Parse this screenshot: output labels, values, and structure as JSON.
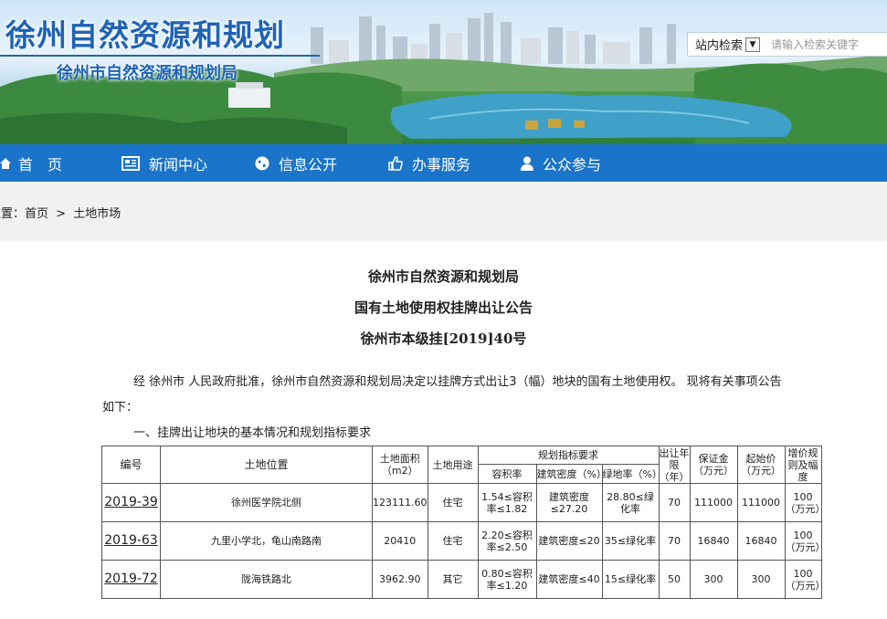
{
  "header": {
    "title": "徐州自然资源和规划",
    "subtitle": "徐州市自然资源和规划局"
  },
  "search": {
    "scope_label": "站内检索",
    "placeholder": "请输入检索关键字"
  },
  "nav": [
    {
      "label": "首　页",
      "icon": "home-icon"
    },
    {
      "label": "新闻中心",
      "icon": "newspaper-icon"
    },
    {
      "label": "信息公开",
      "icon": "globe-icon"
    },
    {
      "label": "办事服务",
      "icon": "thumbs-up-icon"
    },
    {
      "label": "公众参与",
      "icon": "user-icon"
    }
  ],
  "breadcrumb": {
    "prefix": "位置：",
    "home": "首页",
    "separator": ">",
    "current": "土地市场"
  },
  "article": {
    "org": "徐州市自然资源和规划局",
    "title": "国有土地使用权挂牌出让公告",
    "number": "徐州市本级挂[2019]40号",
    "intro_line1": "经 徐州市 人民政府批准，徐州市自然资源和规划局决定以挂牌方式出让3（幅）地块的国有土地使用权。 现将有关事项公告",
    "intro_line2": "如下：",
    "section1": "一、挂牌出让地块的基本情况和规划指标要求"
  },
  "table": {
    "headers": {
      "code": "编号",
      "location": "土地位置",
      "area": "土地面积（m2）",
      "use": "土地用途",
      "planning": "规划指标要求",
      "far": "容积率",
      "density": "建筑密度（%）",
      "green": "绿地率（%）",
      "term": "出让年限（年）",
      "deposit": "保证金（万元）",
      "start_price": "起始价（万元）",
      "increment": "增价规则及幅度"
    },
    "rows": [
      {
        "code": "2019-39",
        "location": "徐州医学院北侧",
        "area": "123111.60",
        "use": "住宅",
        "far": "1.54≤容积率≤1.82",
        "density": "建筑密度≤27.20",
        "green": "28.80≤绿化率",
        "term": "70",
        "deposit": "111000",
        "start_price": "111000",
        "increment": "100（万元）"
      },
      {
        "code": "2019-63",
        "location": "九里小学北，龟山南路南",
        "area": "20410",
        "use": "住宅",
        "far": "2.20≤容积率≤2.50",
        "density": "建筑密度≤20",
        "green": "35≤绿化率",
        "term": "70",
        "deposit": "16840",
        "start_price": "16840",
        "increment": "100（万元）"
      },
      {
        "code": "2019-72",
        "location": "陇海铁路北",
        "area": "3962.90",
        "use": "其它",
        "far": "0.80≤容积率≤1.20",
        "density": "建筑密度≤40",
        "green": "15≤绿化率",
        "term": "50",
        "deposit": "300",
        "start_price": "300",
        "increment": "100（万元）"
      }
    ]
  }
}
